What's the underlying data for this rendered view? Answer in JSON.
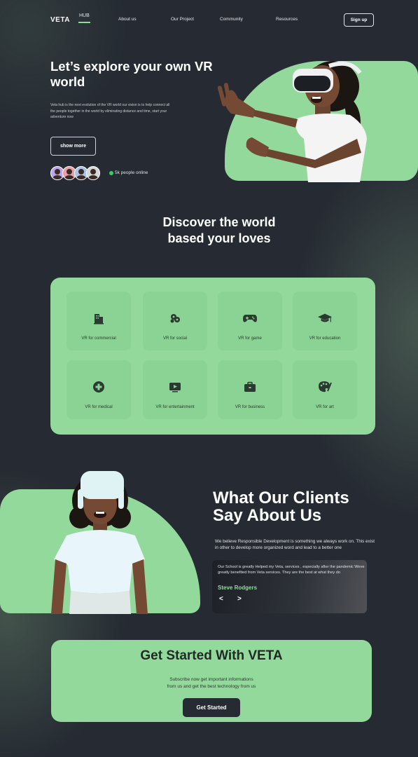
{
  "nav": {
    "logo": "VETA",
    "hub": "HUB",
    "links": [
      "About us",
      "Our Project",
      "Community",
      "Resources"
    ],
    "signup": "Sign up"
  },
  "hero": {
    "title": "Let’s explore your own VR world",
    "description": "Veta hub is the next evolution of the VR world our vision is to help connect all the people together in the world by eliminating distance and time, start your adventure now",
    "button": "show more",
    "online": "5k people online"
  },
  "discover": {
    "title_line1": "Discover the world",
    "title_line2": "based your loves",
    "categories": [
      {
        "label": "VR for commercial",
        "icon": "building-icon"
      },
      {
        "label": "VR for social",
        "icon": "social-icon"
      },
      {
        "label": "VR for game",
        "icon": "gamepad-icon"
      },
      {
        "label": "VR for education",
        "icon": "graduation-cap-icon"
      },
      {
        "label": "VR for medical",
        "icon": "medical-plus-icon"
      },
      {
        "label": "VR for entertainment",
        "icon": "tv-play-icon"
      },
      {
        "label": "VR for business",
        "icon": "briefcase-icon"
      },
      {
        "label": "VR for art",
        "icon": "palette-icon"
      }
    ]
  },
  "clients": {
    "title_line1": "What Our Clients",
    "title_line2": "Say About Us",
    "description": "We believe Responsible Development is something we always work on. This exist in other to develop more organized word and lead to a better one",
    "testimonial": "Our School is greatly Helped my Veta, services , especially after the pandemic Weve greatly benefited from Veta services. They are the best at what they do",
    "author": "Steve Rodgers",
    "prev": "<",
    "next": ">"
  },
  "cta": {
    "title": "Get Started With VETA",
    "description_line1": "Subscribe now get important informations",
    "description_line2": "from us and get the best technology from us",
    "button": "Get Started"
  },
  "colors": {
    "background": "#262b33",
    "accent_green": "#93d99c",
    "online_green": "#34d15a"
  }
}
